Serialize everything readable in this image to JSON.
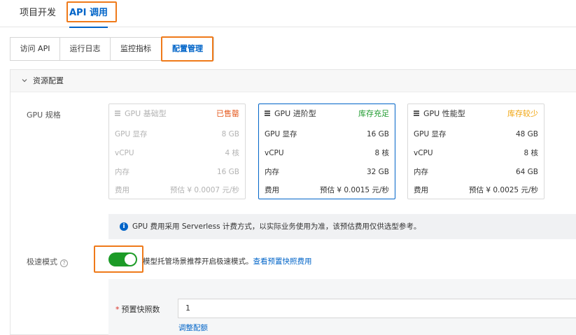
{
  "top_tabs": [
    {
      "label": "项目开发"
    },
    {
      "label": "API 调用"
    }
  ],
  "sub_tabs": [
    {
      "label": "访问 API"
    },
    {
      "label": "运行日志"
    },
    {
      "label": "监控指标"
    },
    {
      "label": "配置管理"
    }
  ],
  "section": {
    "title": "资源配置"
  },
  "gpu_spec": {
    "label": "GPU 规格",
    "cards": [
      {
        "name": "GPU 基础型",
        "status": "已售罄",
        "status_color": "#e55a1f",
        "disabled": true,
        "selected": false,
        "rows": [
          {
            "k": "GPU 显存",
            "v": "8 GB"
          },
          {
            "k": "vCPU",
            "v": "4 核"
          },
          {
            "k": "内存",
            "v": "16 GB"
          },
          {
            "k": "费用",
            "v": "预估 ¥ 0.0007 元/秒"
          }
        ]
      },
      {
        "name": "GPU 进阶型",
        "status": "库存充足",
        "status_color": "#1f9a2e",
        "disabled": false,
        "selected": true,
        "rows": [
          {
            "k": "GPU 显存",
            "v": "16 GB"
          },
          {
            "k": "vCPU",
            "v": "8 核"
          },
          {
            "k": "内存",
            "v": "32 GB"
          },
          {
            "k": "费用",
            "v": "预估 ¥ 0.0015 元/秒"
          }
        ]
      },
      {
        "name": "GPU 性能型",
        "status": "库存较少",
        "status_color": "#f0a30a",
        "disabled": false,
        "selected": false,
        "rows": [
          {
            "k": "GPU 显存",
            "v": "48 GB"
          },
          {
            "k": "vCPU",
            "v": "8 核"
          },
          {
            "k": "内存",
            "v": "64 GB"
          },
          {
            "k": "费用",
            "v": "预估 ¥ 0.0025 元/秒"
          }
        ]
      }
    ],
    "info": "GPU 费用采用 Serverless 计费方式，以实际业务使用为准，该预估费用仅供选型参考。"
  },
  "fast_mode": {
    "label": "极速模式",
    "enabled": true,
    "description": "模型托管场景推荐开启极速模式。",
    "link": "查看预置快照费用"
  },
  "snapshot": {
    "label": "预置快照数",
    "value": "1",
    "adjust_link": "调整配额"
  },
  "colors": {
    "accent": "#0064c8",
    "highlight": "#ef7a1a",
    "toggle_on": "#1c9b27"
  }
}
